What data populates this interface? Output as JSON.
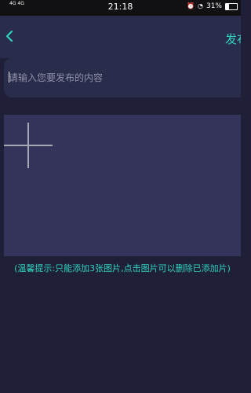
{
  "status_bar": {
    "signal_left": "4G",
    "signal_left2": "4G",
    "time": "21:18",
    "battery_percent": "31%"
  },
  "nav": {
    "back_icon": "back-icon",
    "publish_label": "发布"
  },
  "editor": {
    "placeholder": "请输入您要发布的内容"
  },
  "image_picker": {
    "add_icon": "plus-icon"
  },
  "tip": {
    "text": "(温馨提示:只能添加3张图片,点击图片可以删除已添加片)"
  },
  "colors": {
    "background": "#1f2037",
    "panel": "#2a2c4b",
    "image_panel": "#34345a",
    "accent": "#2fd3be",
    "plus": "#a6a7b5"
  }
}
